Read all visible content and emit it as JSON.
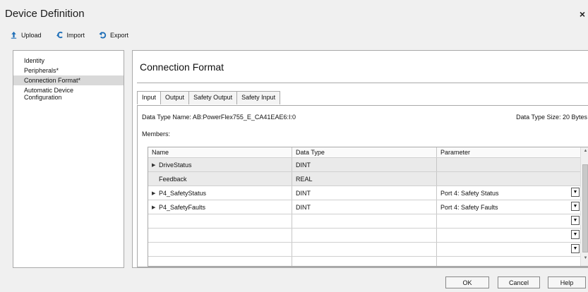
{
  "window": {
    "title": "Device Definition",
    "close": "×"
  },
  "toolbar": {
    "upload": "Upload",
    "import": "Import",
    "export": "Export"
  },
  "nav": {
    "items": [
      "Identity",
      "Peripherals*",
      "Connection Format*",
      "Automatic Device Configuration"
    ],
    "selected": 2
  },
  "main": {
    "title": "Connection Format"
  },
  "tabs": [
    "Input",
    "Output",
    "Safety Output",
    "Safety Input"
  ],
  "panel": {
    "data_type_name": "Data Type Name:  AB:PowerFlex755_E_CA41EAE6:I:0",
    "data_type_size": "Data Type Size:  20 Bytes",
    "members_label": "Members:"
  },
  "grid": {
    "headers": [
      "Name",
      "Data Type",
      "Parameter"
    ],
    "rows": [
      {
        "name": "DriveStatus",
        "type": "DINT",
        "param": ""
      },
      {
        "name": "Feedback",
        "type": "REAL",
        "param": ""
      },
      {
        "name": "P4_SafetyStatus",
        "type": "DINT",
        "param": "Port 4: Safety Status"
      },
      {
        "name": "P4_SafetyFaults",
        "type": "DINT",
        "param": "Port 4: Safety Faults"
      }
    ]
  },
  "buttons": {
    "ok": "OK",
    "cancel": "Cancel",
    "help": "Help"
  }
}
